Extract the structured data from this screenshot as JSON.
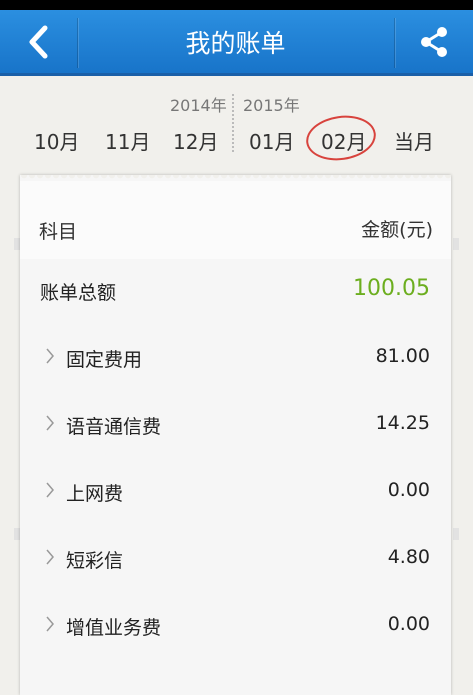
{
  "header": {
    "title": "我的账单",
    "back_icon": "chevron-left-icon",
    "share_icon": "share-icon",
    "bg_color": "#1a7ad4"
  },
  "months": {
    "year_left": "2014年",
    "year_right": "2015年",
    "items": [
      "10月",
      "11月",
      "12月",
      "01月",
      "02月",
      "当月"
    ],
    "selected": "02月",
    "selected_ring_color": "#d8433d"
  },
  "bill": {
    "col_subject": "科目",
    "col_amount": "金额(元)",
    "total_label": "账单总额",
    "total_value": "100.05",
    "total_color": "#6cae1f",
    "rows": [
      {
        "label": "固定费用",
        "value": "81.00"
      },
      {
        "label": "语音通信费",
        "value": "14.25"
      },
      {
        "label": "上网费",
        "value": "0.00"
      },
      {
        "label": "短彩信",
        "value": "4.80"
      },
      {
        "label": "增值业务费",
        "value": "0.00"
      }
    ]
  }
}
